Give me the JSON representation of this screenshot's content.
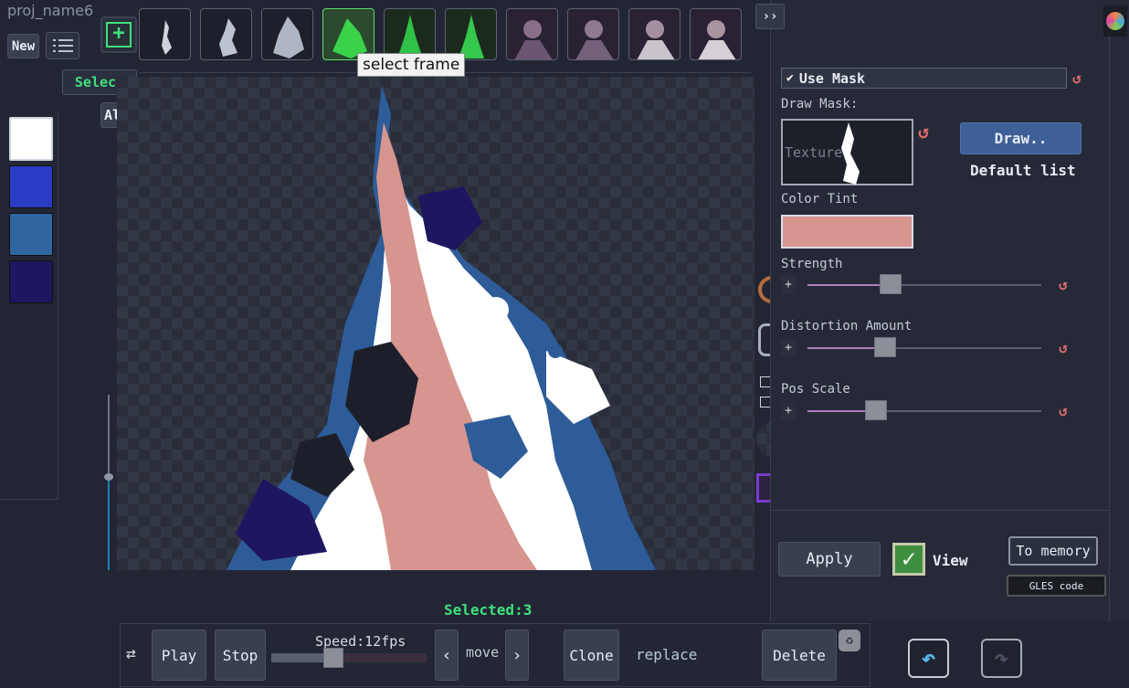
{
  "project": {
    "name": "proj_name6"
  },
  "toolbar_left": {
    "new_label": "New",
    "select_label": "Select",
    "all_label": "All"
  },
  "frames": {
    "tooltip": "select frame",
    "count": 10,
    "selected_index": 3
  },
  "palette": {
    "colors": [
      "#ffffff",
      "#2a3bc4",
      "#2f66a0",
      "#1e1660"
    ]
  },
  "panel": {
    "collapse_label": "››",
    "use_mask_label": "Use Mask",
    "draw_mask_label": "Draw Mask:",
    "texture_label": "Texture",
    "draw_button": "Draw..",
    "default_list": "Default list",
    "color_tint_label": "Color Tint",
    "color_tint_value": "#d79590",
    "strength_label": "Strength",
    "strength_value": 0.25,
    "distortion_label": "Distortion Amount",
    "distortion_value": 0.22,
    "pos_scale_label": "Pos Scale",
    "pos_scale_value": 0.19,
    "apply_label": "Apply",
    "view_label": "View",
    "to_memory_label": "To memory",
    "gles_label": "GLES code"
  },
  "status": {
    "selected": "Selected:3"
  },
  "playback": {
    "play": "Play",
    "stop": "Stop",
    "speed": "Speed:12fps",
    "speed_value": 0.4,
    "prev": "‹",
    "move": "move",
    "next": "›",
    "clone": "Clone",
    "replace": "replace",
    "delete": "Delete"
  }
}
